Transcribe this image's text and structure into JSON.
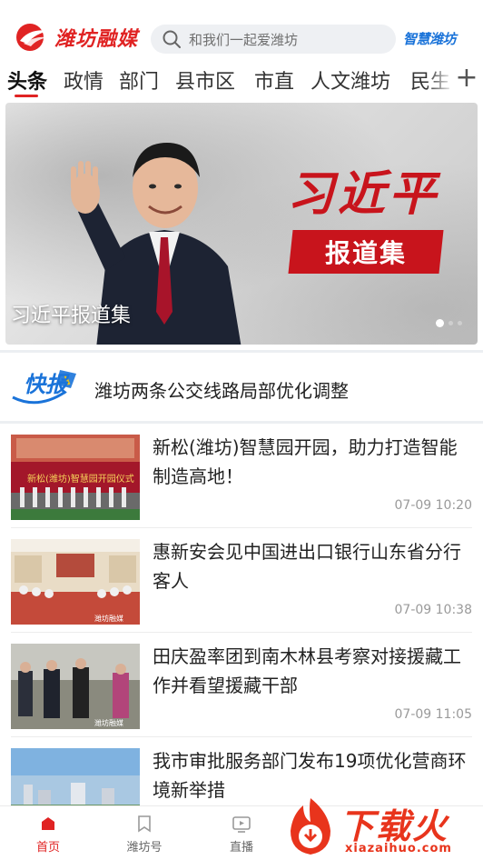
{
  "header": {
    "logo_text": "潍坊融媒",
    "search_placeholder": "和我们一起爱潍坊",
    "brand_right": "智慧潍坊"
  },
  "tabs": [
    {
      "label": "头条",
      "active": true
    },
    {
      "label": "政情"
    },
    {
      "label": "部门"
    },
    {
      "label": "县市区"
    },
    {
      "label": "市直"
    },
    {
      "label": "人文潍坊"
    },
    {
      "label": "民生"
    }
  ],
  "banner": {
    "calligraphy": "习近平",
    "ribbon": "报道集",
    "caption": "习近平报道集",
    "slide_index": 1,
    "slide_count": 3
  },
  "flash": {
    "logo_text": "快报",
    "text": "潍坊两条公交线路局部优化调整"
  },
  "news": [
    {
      "title": "新松(潍坊)智慧园开园，助力打造智能制造高地！",
      "time": "07-09 10:20"
    },
    {
      "title": "惠新安会见中国进出口银行山东省分行客人",
      "time": "07-09 10:38"
    },
    {
      "title": "田庆盈率团到南木林县考察对接援藏工作并看望援藏干部",
      "time": "07-09 11:05"
    },
    {
      "title": "我市审批服务部门发布19项优化营商环境新举措",
      "time": ""
    }
  ],
  "thumb_texts": {
    "stage_banner": "新松(潍坊)智慧园开园仪式",
    "tv_logo": "潍坊融媒"
  },
  "bottom_nav": [
    {
      "label": "首页",
      "icon": "home-icon",
      "active": true
    },
    {
      "label": "潍坊号",
      "icon": "bookmark-icon"
    },
    {
      "label": "直播",
      "icon": "tv-icon"
    }
  ],
  "watermark": {
    "text": "下载火",
    "sub": "xiazaihuo.com"
  },
  "colors": {
    "brand_red": "#e02323",
    "brand_blue": "#1a73d9",
    "time_gray": "#9a9a9a"
  }
}
